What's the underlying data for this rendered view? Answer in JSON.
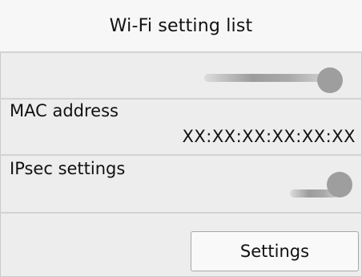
{
  "title": "Wi-Fi setting list",
  "network_name": {
    "redacted": true
  },
  "mac_address": {
    "label": "MAC address",
    "value": "XX:XX:XX:XX:XX:XX"
  },
  "ipsec": {
    "label": "IPsec settings",
    "redacted": true
  },
  "settings_button": {
    "label": "Settings"
  }
}
